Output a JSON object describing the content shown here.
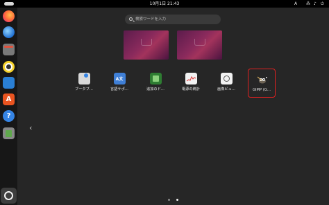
{
  "topbar": {
    "clock": "10月1日  21:43",
    "input_method": "A",
    "network_symbol": "⁂",
    "volume_symbol": "♪",
    "power_symbol": "⏻"
  },
  "dock": {
    "items": [
      {
        "name": "firefox",
        "icon": "firefox-icon"
      },
      {
        "name": "thunderbird",
        "icon": "mail-icon"
      },
      {
        "name": "files",
        "icon": "folder-icon"
      },
      {
        "name": "rhythmbox",
        "icon": "music-icon"
      },
      {
        "name": "writer",
        "icon": "document-icon"
      },
      {
        "name": "app-center",
        "icon": "store-icon",
        "glyph": "A"
      },
      {
        "name": "help",
        "icon": "help-icon",
        "glyph": "?"
      },
      {
        "name": "trash",
        "icon": "trash-icon"
      }
    ],
    "show_apps_icon": "ubuntu-apps-icon"
  },
  "search": {
    "placeholder": "検索ワードを入力"
  },
  "apps": [
    {
      "label": "ブータブ…",
      "icon": "usb-icon"
    },
    {
      "label": "言語サポ…",
      "icon": "language-icon",
      "glyph": "A文"
    },
    {
      "label": "追加のド…",
      "icon": "chip-icon"
    },
    {
      "label": "電源の統計",
      "icon": "power-stats-icon"
    },
    {
      "label": "画像ビュ…",
      "icon": "image-viewer-icon"
    },
    {
      "label": "GIMP (G…",
      "icon": "gimp-icon"
    }
  ],
  "nav": {
    "prev_glyph": "‹"
  },
  "pages": {
    "count": 2,
    "current": 2
  },
  "colors": {
    "highlight": "#e02020",
    "background": "#262626",
    "topbar": "#000000"
  }
}
